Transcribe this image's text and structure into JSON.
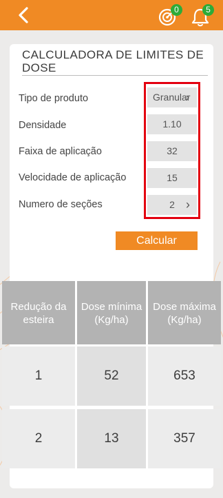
{
  "header": {
    "notifications": [
      {
        "icon": "target-icon",
        "count": "0"
      },
      {
        "icon": "bell-icon",
        "count": "5"
      }
    ],
    "accent_color": "#f08a24",
    "badge_color": "#2eab39"
  },
  "calculator": {
    "title": "CALCULADORA DE LIMITES DE DOSE",
    "fields": [
      {
        "label": "Tipo de produto",
        "value": "Granular"
      },
      {
        "label": "Densidade",
        "value": "1.10"
      },
      {
        "label": "Faixa de aplicação",
        "value": "32"
      },
      {
        "label": "Velocidade de aplicação",
        "value": "15"
      },
      {
        "label": "Numero de seções",
        "value": "2"
      }
    ],
    "calculate_label": "Calcular"
  },
  "results": {
    "headers": [
      "Redução da esteira",
      "Dose mínima (Kg/ha)",
      "Dose máxima (Kg/ha)"
    ],
    "rows": [
      [
        "1",
        "52",
        "653"
      ],
      [
        "2",
        "13",
        "357"
      ]
    ]
  }
}
